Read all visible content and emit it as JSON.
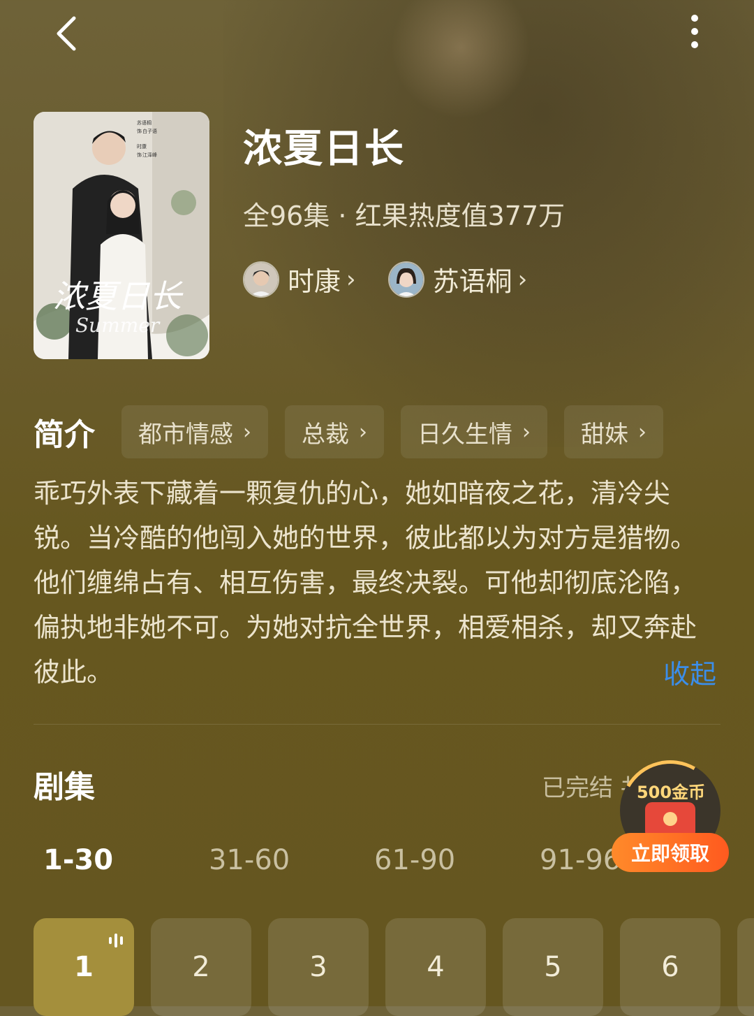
{
  "header": {
    "back_icon": "back-arrow-icon",
    "more_icon": "more-vertical-icon"
  },
  "drama": {
    "title": "浓夏日长",
    "meta": "全96集 · 红果热度值377万",
    "poster": {
      "calligraphy": "浓夏日长",
      "script": "Summer",
      "credits": [
        "苏语桐",
        "饰",
        "白子语",
        "时康",
        "饰",
        "江泽峰"
      ]
    },
    "actors": [
      {
        "name": "时康",
        "chevron": "›"
      },
      {
        "name": "苏语桐",
        "chevron": "›"
      }
    ]
  },
  "intro": {
    "label": "简介",
    "tags": [
      {
        "label": "都市情感",
        "chevron": "›"
      },
      {
        "label": "总裁",
        "chevron": "›"
      },
      {
        "label": "日久生情",
        "chevron": "›"
      },
      {
        "label": "甜妹",
        "chevron": "›"
      }
    ],
    "synopsis": "乖巧外表下藏着一颗复仇的心，她如暗夜之花，清冷尖锐。当冷酷的他闯入她的世界，彼此都以为对方是猎物。他们缠绵占有、相互伤害，最终决裂。可他却彻底沦陷，偏执地非她不可。为她对抗全世界，相爱相杀，却又奔赴彼此。",
    "collapse_label": "收起"
  },
  "episodes": {
    "label": "剧集",
    "status": "已完结 共96集 ›",
    "ranges": [
      "1-30",
      "31-60",
      "61-90",
      "91-96"
    ],
    "active_range": "1-30",
    "items": [
      "1",
      "2",
      "3",
      "4",
      "5",
      "6"
    ],
    "playing_episode": "1"
  },
  "promo": {
    "coins": "500金币",
    "button": "立即领取"
  },
  "colors": {
    "background": "#66571f",
    "active_episode": "#a48f3c",
    "link": "#3b8eea",
    "promo_button": "#ff6a22"
  }
}
